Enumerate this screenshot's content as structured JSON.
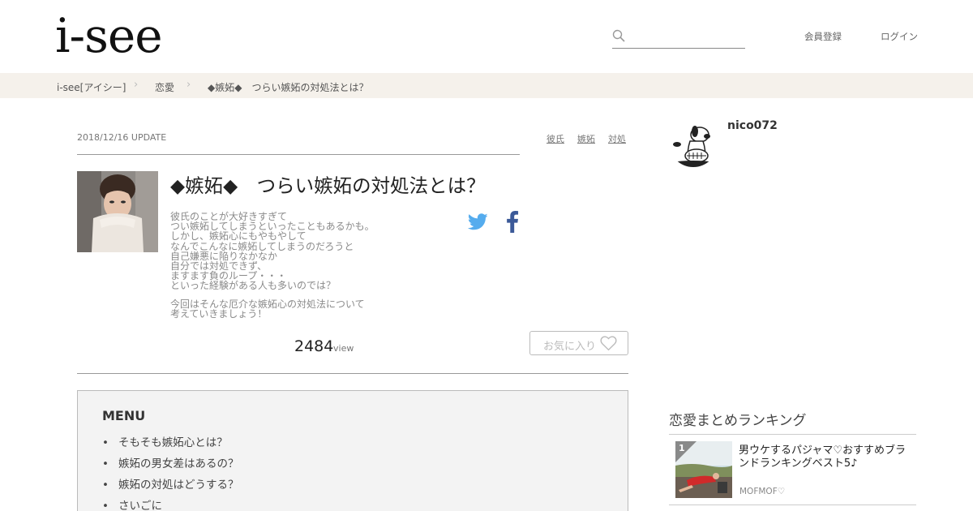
{
  "header": {
    "logo": "i-see",
    "search_placeholder": "",
    "register_label": "会員登録",
    "login_label": "ログイン"
  },
  "breadcrumb": {
    "items": [
      "i-see[アイシー]",
      "恋愛",
      "◆嫉妬◆　つらい嫉妬の対処法とは？"
    ]
  },
  "article": {
    "date": "2018/12/16 UPDATE",
    "tags": [
      "彼氏",
      "嫉妬",
      "対処"
    ],
    "title": "◆嫉妬◆　つらい嫉妬の対処法とは？",
    "description_lines": [
      "彼氏のことが大好きすぎて",
      "つい嫉妬してしまうといったこともあるかも。",
      "しかし、嫉妬心にもやもやして",
      "なんでこんなに嫉妬してしまうのだろうと",
      "自己嫌悪に陥りなかなか",
      "自分では対処できず、",
      "ますます負のループ・・・",
      "といった経験がある人も多いのでは？"
    ],
    "description_lines_2": [
      "今回はそんな厄介な嫉妬心の対処法について",
      "考えていきましょう！"
    ],
    "views": "2484",
    "views_unit": "view",
    "favorite_label": "お気に入り"
  },
  "menu": {
    "title": "MENU",
    "items": [
      "そもそも嫉妬心とは？",
      "嫉妬の男女差はあるの？",
      "嫉妬の対処はどうする？",
      "さいごに"
    ]
  },
  "sidebar": {
    "username": "nico072",
    "ranking_title": "恋愛まとめランキング",
    "ranking": [
      {
        "rank": "1",
        "title": "男ウケするパジャマ♡おすすめブランドランキングベスト5♪",
        "author": "MOFMOF♡"
      }
    ]
  },
  "colors": {
    "breadcrumb_bg": "#f5f1eb",
    "twitter": "#55acee",
    "facebook": "#3b5998",
    "menu_bg": "#f3f3f3"
  }
}
